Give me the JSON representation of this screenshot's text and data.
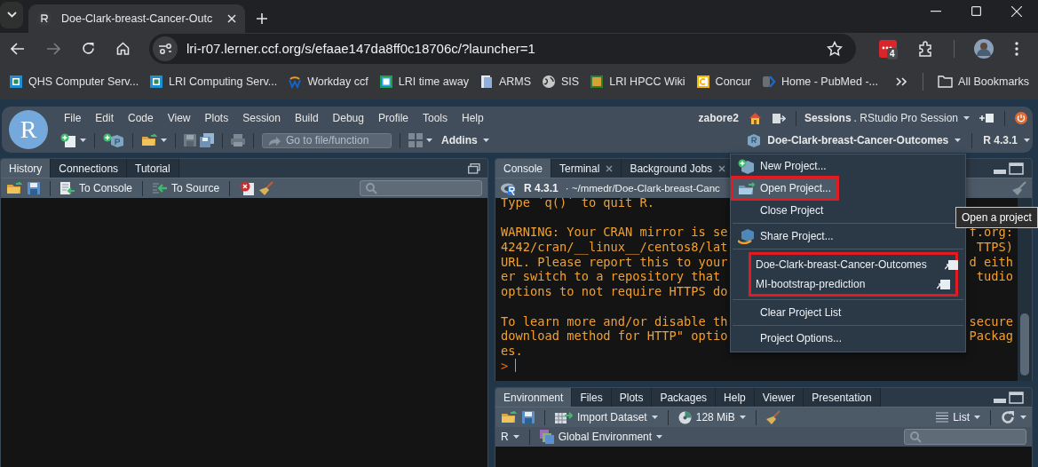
{
  "browser": {
    "tabs": [
      {
        "title": "Doe-Clark-breast-Cancer-Outc",
        "selected": true
      }
    ],
    "url": "lri-r07.lerner.ccf.org/s/efaae147da8ff0c18706c/?launcher=1",
    "extension_badge": "4",
    "bookmarks": [
      {
        "label": "QHS Computer Serv..."
      },
      {
        "label": "LRI Computing Serv..."
      },
      {
        "label": "Workday ccf"
      },
      {
        "label": "LRI time away"
      },
      {
        "label": "ARMS"
      },
      {
        "label": "SIS"
      },
      {
        "label": "LRI HPCC Wiki"
      },
      {
        "label": "Concur"
      },
      {
        "label": "Home - PubMed -..."
      }
    ],
    "all_bookmarks": "All Bookmarks"
  },
  "rstudio": {
    "logo": "R",
    "menu": [
      "File",
      "Edit",
      "Code",
      "View",
      "Plots",
      "Session",
      "Build",
      "Debug",
      "Profile",
      "Tools",
      "Help"
    ],
    "user": "zabore2",
    "sessions_label": "Sessions",
    "session_name": ". RStudio Pro Session",
    "goto_placeholder": "Go to file/function",
    "addins": "Addins",
    "project": "Doe-Clark-breast-Cancer-Outcomes",
    "r_version": "R 4.3.1"
  },
  "history_pane": {
    "tabs": [
      {
        "label": "History",
        "selected": true
      },
      {
        "label": "Connections",
        "selected": false
      },
      {
        "label": "Tutorial",
        "selected": false
      }
    ],
    "to_console": "To Console",
    "to_source": "To Source"
  },
  "console_pane": {
    "tabs": [
      {
        "label": "Console",
        "selected": true,
        "closable": false
      },
      {
        "label": "Terminal",
        "selected": false,
        "closable": true
      },
      {
        "label": "Background Jobs",
        "selected": false,
        "closable": true
      }
    ],
    "r_version": "R 4.3.1",
    "path": "· ~/mmedr/Doe-Clark-breast-Canc",
    "lines": [
      {
        "left": "Type `q()` to quit R."
      },
      {
        "left": "WARNING: Your CRAN mirror is se",
        "right": "f.org:",
        "blank_before": true
      },
      {
        "left": "4242/cran/__linux__/centos8/lat",
        "right": "TTPS)"
      },
      {
        "left": "URL. Please report this to your",
        "right": "d eith"
      },
      {
        "left": "er switch to a repository that",
        "right": "tudio"
      },
      {
        "left": "options to not require HTTPS do"
      },
      {
        "left": "To learn more and/or disable th",
        "right": "secure",
        "blank_before": true
      },
      {
        "left": "download method for HTTP\" optio",
        "right": "Packag"
      },
      {
        "left": "es."
      }
    ],
    "prompt": ">"
  },
  "environment_pane": {
    "tabs": [
      {
        "label": "Environment",
        "selected": true
      },
      {
        "label": "Files",
        "selected": false
      },
      {
        "label": "Plots",
        "selected": false
      },
      {
        "label": "Packages",
        "selected": false
      },
      {
        "label": "Help",
        "selected": false
      },
      {
        "label": "Viewer",
        "selected": false
      },
      {
        "label": "Presentation",
        "selected": false
      }
    ],
    "import": "Import Dataset",
    "memory": "128 MiB",
    "view": "List",
    "language": "R",
    "environment": "Global Environment"
  },
  "project_menu": {
    "items": [
      {
        "kind": "action",
        "label": "New Project...",
        "selected": false,
        "outlined": false
      },
      {
        "kind": "action",
        "label": "Open Project...",
        "selected": true,
        "outlined": true
      },
      {
        "kind": "plain",
        "label": "Close Project",
        "selected": false,
        "outlined": false
      },
      {
        "kind": "divider"
      },
      {
        "kind": "action",
        "label": "Share Project...",
        "selected": false,
        "outlined": false
      },
      {
        "kind": "divider"
      },
      {
        "kind": "recent",
        "label": "Doe-Clark-breast-Cancer-Outcomes",
        "selected": false,
        "outlined": true
      },
      {
        "kind": "recent",
        "label": "MI-bootstrap-prediction",
        "selected": false,
        "outlined": true
      },
      {
        "kind": "divider"
      },
      {
        "kind": "plain",
        "label": "Clear Project List",
        "selected": false,
        "outlined": false
      },
      {
        "kind": "divider"
      },
      {
        "kind": "plain",
        "label": "Project Options...",
        "selected": false,
        "outlined": false
      }
    ]
  },
  "tooltip": "Open a project"
}
